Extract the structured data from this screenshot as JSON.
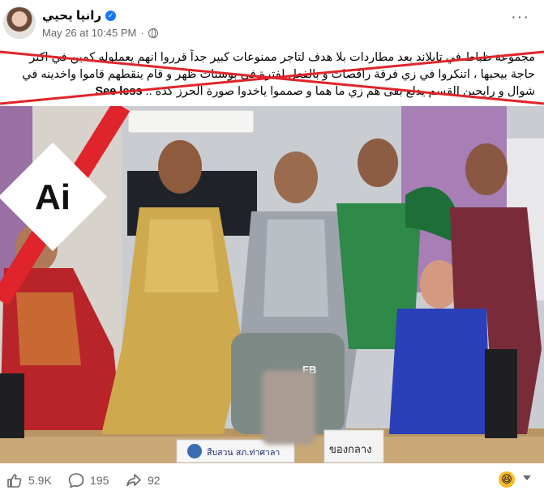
{
  "post": {
    "author": "رانيا يحيي",
    "timestamp": "May 26 at 10:45 PM",
    "separator": "·",
    "more_label": "···",
    "caption": "مجموعة ظباط في تايلاند بعد مطاردات بلا هدف لتاجر ممنوعات كبير جداً قرروا انهم يعملوله كمين في اكتر حاجة بيحبها ، اتنكروا في زي فرقة راقصات و بالفعل لفترة في بوستات ظهر و قام ينقطهم قاموا واخدينه في شوال و رايحين القسم يدلع بقى هم زي ما هما و صمموا ياخدوا صورة الحرز كده .. ",
    "see_less": "See less"
  },
  "image": {
    "ai_label": "Ai",
    "nameplate_left": "สืบสวน สภ.ท่าศาลา",
    "nameplate_right": "ของกลาง",
    "shirt_logo": "FB"
  },
  "stats": {
    "likes": "5.9K",
    "comments": "195",
    "shares": "92"
  },
  "colors": {
    "strike_red": "#e0242b",
    "verified_blue": "#1877f2"
  }
}
